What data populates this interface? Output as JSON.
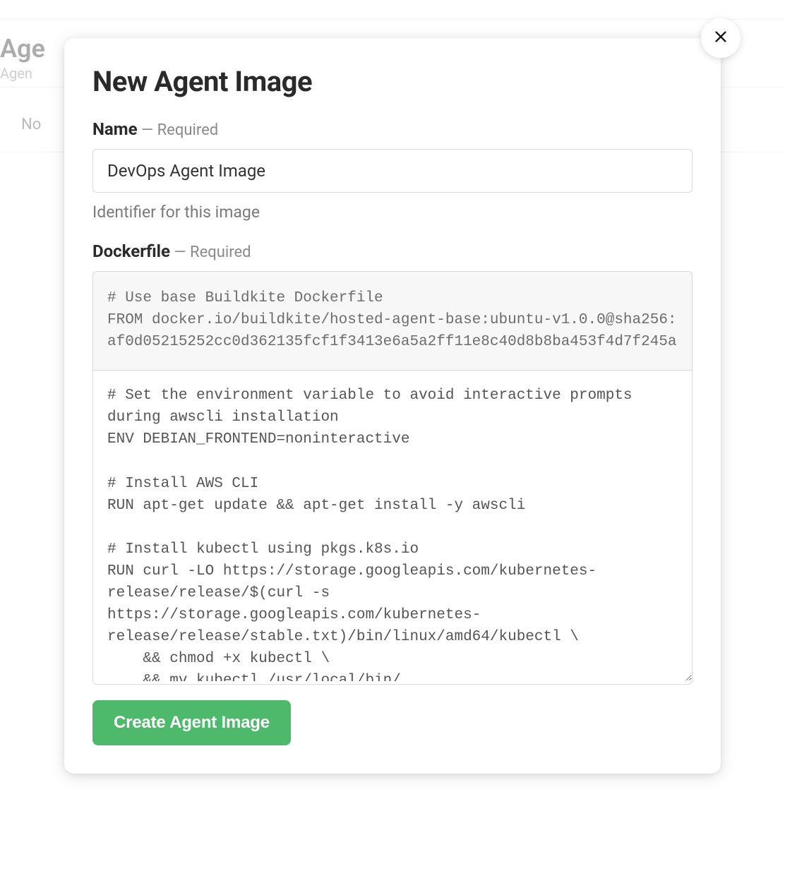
{
  "background": {
    "title_fragment": "Age",
    "subtitle_fragment": "Agen",
    "tab_fragment": "No"
  },
  "modal": {
    "title": "New Agent Image",
    "fields": {
      "name": {
        "label": "Name",
        "required_text": " — Required",
        "value": "DevOps Agent Image",
        "help": "Identifier for this image"
      },
      "dockerfile": {
        "label": "Dockerfile",
        "required_text": " — Required",
        "base_content": "# Use base Buildkite Dockerfile\nFROM docker.io/buildkite/hosted-agent-base:ubuntu-v1.0.0@sha256:af0d05215252cc0d362135fcf1f3413e6a5a2ff11e8c40d8b8ba453f4d7f245a",
        "editable_content": "# Set the environment variable to avoid interactive prompts during awscli installation\nENV DEBIAN_FRONTEND=noninteractive\n\n# Install AWS CLI\nRUN apt-get update && apt-get install -y awscli\n\n# Install kubectl using pkgs.k8s.io\nRUN curl -LO https://storage.googleapis.com/kubernetes-release/release/$(curl -s https://storage.googleapis.com/kubernetes-release/release/stable.txt)/bin/linux/amd64/kubectl \\\n    && chmod +x kubectl \\\n    && mv kubectl /usr/local/bin/"
      }
    },
    "submit_label": "Create Agent Image"
  }
}
